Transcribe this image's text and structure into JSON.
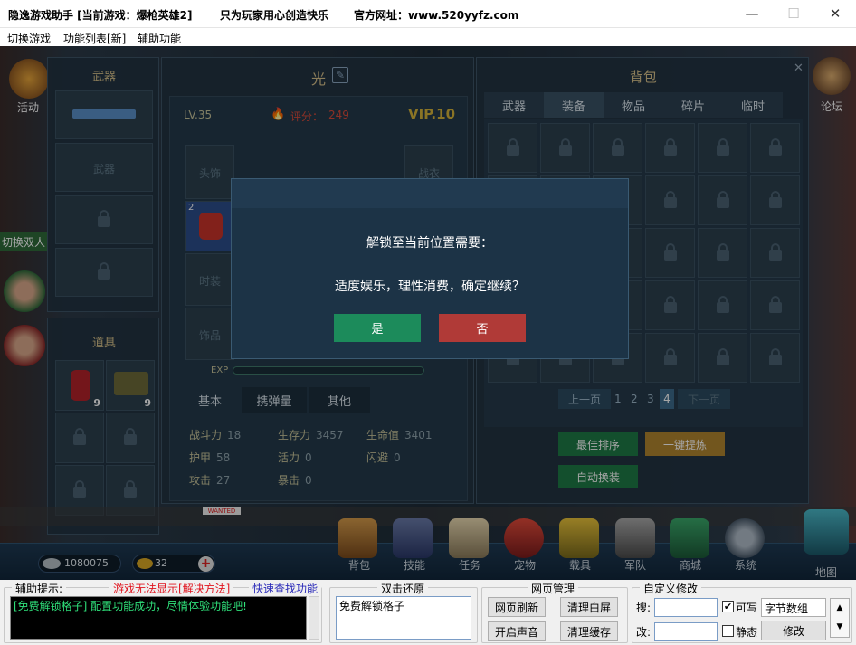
{
  "window": {
    "title": "隐逸游戏助手 [当前游戏：爆枪英雄2]",
    "slogan": "只为玩家用心创造快乐",
    "website": "官方网址：www.520yyfz.com",
    "minimize": "—",
    "maximize": "☐",
    "close": "✕"
  },
  "menu": [
    "切换游戏",
    "功能列表[新]",
    "辅助功能"
  ],
  "game": {
    "left_icons": {
      "activity": "活动",
      "switch_dual": "切换双人"
    },
    "right_icons": {
      "forum": "论坛"
    },
    "weapon_panel": {
      "title": "武器",
      "slot_label": "武器"
    },
    "item_panel": {
      "title": "道具",
      "items": [
        {
          "count": "9"
        },
        {
          "count": "9"
        }
      ]
    },
    "character": {
      "name": "光",
      "level": "LV.35",
      "score_label": "评分：",
      "score": "249",
      "vip": "VIP.10",
      "slots": {
        "head": "头饰",
        "battle": "战衣",
        "fashion": "时装",
        "ornament": "饰品",
        "glove_count": "2"
      },
      "exp_label": "EXP",
      "tabs": [
        "基本",
        "携弹量",
        "其他"
      ],
      "stats": [
        {
          "label": "战斗力",
          "value": "18"
        },
        {
          "label": "生存力",
          "value": "3457"
        },
        {
          "label": "生命值",
          "value": "3401"
        },
        {
          "label": "护甲",
          "value": "58"
        },
        {
          "label": "活力",
          "value": "0"
        },
        {
          "label": "闪避",
          "value": "0"
        },
        {
          "label": "攻击",
          "value": "27"
        },
        {
          "label": "暴击",
          "value": "0"
        }
      ]
    },
    "bag": {
      "title": "背包",
      "close": "✕",
      "tabs": [
        "武器",
        "装备",
        "物品",
        "碎片",
        "临时"
      ],
      "pagination": {
        "prev": "上一页",
        "pages": [
          "1",
          "2",
          "3",
          "4"
        ],
        "current": "4",
        "next": "下一页"
      },
      "buttons": {
        "sort": "最佳排序",
        "refine": "一键提炼",
        "auto_equip": "自动换装"
      }
    },
    "dialog": {
      "message1": "解锁至当前位置需要：",
      "message2": "适度娱乐，理性消费，确定继续？",
      "yes": "是",
      "no": "否"
    },
    "currency": {
      "silver": "1080075",
      "gold": "32",
      "add": "+"
    },
    "nav": [
      "背包",
      "技能",
      "任务",
      "宠物",
      "载具",
      "军队",
      "商城",
      "系统"
    ],
    "map": "地图",
    "banner": "WANTED"
  },
  "tool": {
    "hint_label": "辅助提示:",
    "no_display": "游戏无法显示[解决方法]",
    "quick_find": "快速查找功能",
    "log_text": "[免费解锁格子] 配置功能成功，尽情体验功能吧!",
    "restore_label": "双击还原",
    "restore_item": "免费解锁格子",
    "web_label": "网页管理",
    "web_refresh": "网页刷新",
    "clear_white": "清理白屏",
    "sound_on": "开启声音",
    "clear_cache": "清理缓存",
    "custom_label": "自定义修改",
    "search_label": "搜:",
    "modify_label": "改:",
    "writable": "可写",
    "static": "静态",
    "byte_type": "字节数组",
    "modify_button": "修改"
  },
  "colors": {
    "yes": "#1c8b5b",
    "no": "#b03a37",
    "accent": "#d6c08a",
    "log_text": "#2fe07a"
  }
}
